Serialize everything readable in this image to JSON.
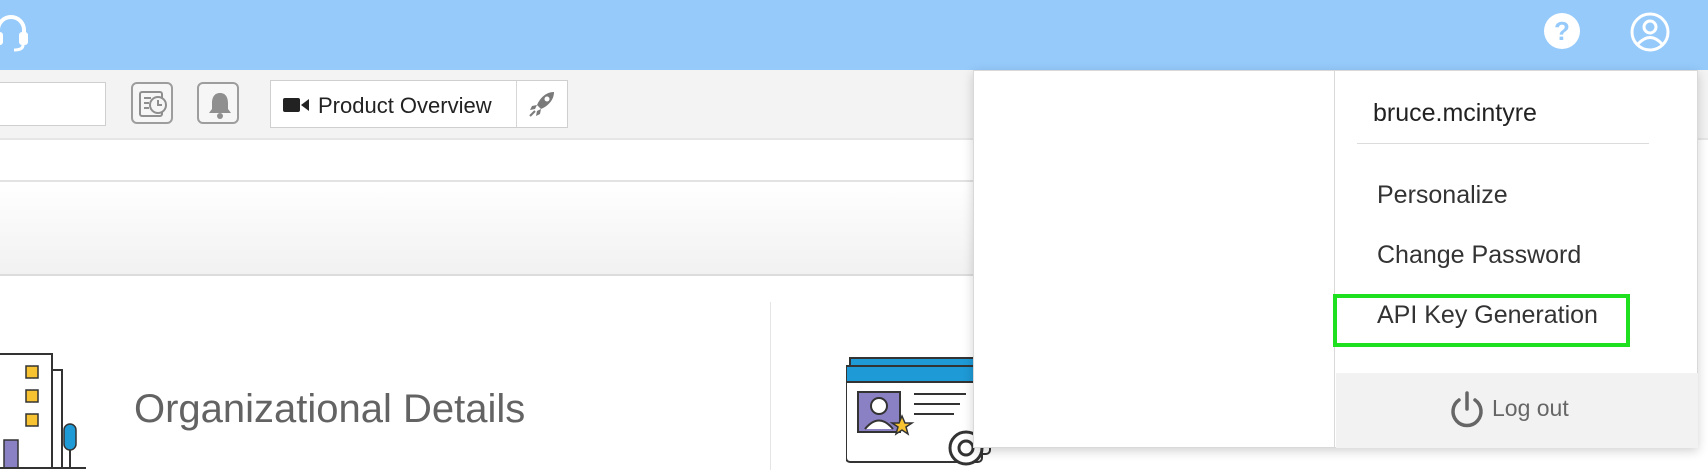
{
  "toolbar": {
    "product_overview_label": "Product Overview"
  },
  "main": {
    "org_card_title": "Organizational Details"
  },
  "user_menu": {
    "username": "bruce.mcintyre",
    "items": [
      {
        "label": "Personalize"
      },
      {
        "label": "Change Password"
      },
      {
        "label": "API Key Generation"
      }
    ],
    "logout_label": "Log out"
  },
  "colors": {
    "topbar": "#95cafb",
    "highlight": "#1ee01e"
  },
  "icons": [
    "headset-icon",
    "help-icon",
    "user-account-icon",
    "history-icon",
    "bell-icon",
    "video-camera-icon",
    "rocket-icon",
    "building-icon",
    "id-card-icon",
    "power-icon"
  ]
}
